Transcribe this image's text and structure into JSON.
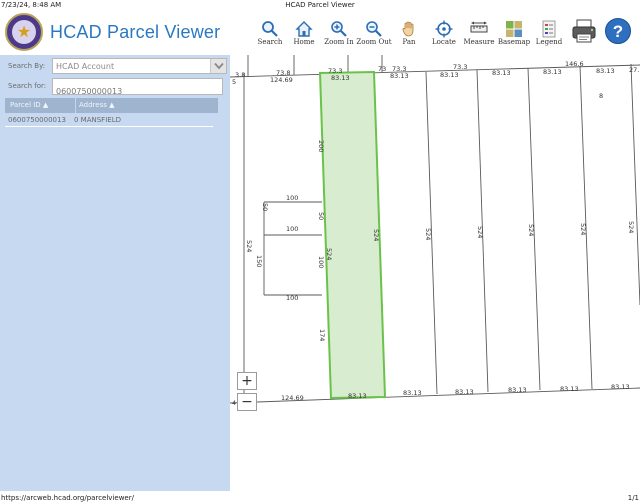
{
  "print": {
    "timestamp": "7/23/24, 8:48 AM",
    "doc_title": "HCAD Parcel Viewer",
    "url": "https://arcweb.hcad.org/parcelviewer/",
    "page": "1/1"
  },
  "header": {
    "title": "HCAD Parcel Viewer",
    "tools": [
      {
        "label": "Search",
        "icon": "search-icon"
      },
      {
        "label": "Home",
        "icon": "home-icon"
      },
      {
        "label": "Zoom In",
        "icon": "zoom-in-icon"
      },
      {
        "label": "Zoom Out",
        "icon": "zoom-out-icon"
      },
      {
        "label": "Pan",
        "icon": "pan-hand-icon"
      },
      {
        "label": "Locate",
        "icon": "locate-crosshair-icon"
      },
      {
        "label": "Measure",
        "icon": "measure-icon"
      },
      {
        "label": "Basemap",
        "icon": "basemap-icon"
      },
      {
        "label": "Legend",
        "icon": "legend-icon"
      }
    ],
    "extra_icons": [
      "printer-icon",
      "help-icon"
    ],
    "help_glyph": "?"
  },
  "sidebar": {
    "search_by_label": "Search By:",
    "search_by_value": "HCAD Account",
    "search_for_label": "Search for:",
    "search_for_value": "0600750000013",
    "columns": [
      "Parcel ID ▲",
      "Address ▲"
    ],
    "results": [
      {
        "parcel_id": "0600750000013",
        "address": "0 MANSFIELD"
      }
    ]
  },
  "map": {
    "labels": {
      "top_edge": [
        "3.8",
        "73.8",
        "73.3",
        "73",
        "73.3",
        "73.3",
        "146.6",
        "27."
      ],
      "upper_row": [
        "5",
        "124.69",
        "83.13",
        "83.13",
        "83.13",
        "83.13",
        "83.13",
        "83.13",
        "83.13"
      ],
      "bottom_row": [
        "4",
        "124.69",
        "83.13",
        "83.13",
        "83.13",
        "83.13",
        "83.13",
        "83.13"
      ],
      "left_parcel": [
        "524",
        "100",
        "50",
        "100",
        "150",
        "100"
      ],
      "selected_parcel": [
        "200",
        "50",
        "100",
        "524",
        "174",
        "524"
      ],
      "lot_depths": [
        "524",
        "524",
        "524",
        "524",
        "524"
      ],
      "lot_number": "8"
    },
    "zoom_in": "+",
    "zoom_out": "−",
    "colors": {
      "selected_fill": "#d8ecd0",
      "selected_stroke": "#6ac24a",
      "line": "#555555"
    }
  }
}
